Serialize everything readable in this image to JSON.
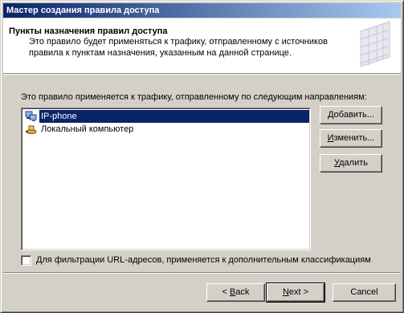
{
  "window": {
    "title": "Мастер создания правила доступа"
  },
  "header": {
    "title": "Пункты назначения правил доступа",
    "description": "Это правило будет применяться к трафику, отправленному с источников правила к пунктам назначения, указанным на данной странице."
  },
  "main": {
    "instruction": "Это правило применяется к трафику, отправленному по следующим направлениям:",
    "destinations": [
      {
        "label": "IP-phone",
        "icon": "network-icon",
        "selected": true
      },
      {
        "label": "Локальный компьютер",
        "icon": "local-computer-icon",
        "selected": false
      }
    ],
    "buttons": {
      "add": {
        "prefix": "",
        "mnemonic": "Д",
        "suffix": "обавить..."
      },
      "edit": {
        "prefix": "",
        "mnemonic": "И",
        "suffix": "зменить..."
      },
      "remove": {
        "prefix": "",
        "mnemonic": "У",
        "suffix": "далить"
      }
    },
    "url_filter_checkbox": {
      "mnemonic": "Д",
      "rest": "ля фильтрации URL-адресов, применяется к дополнительным классификациям",
      "checked": false
    }
  },
  "footer": {
    "back": {
      "prefix": "< ",
      "mnemonic": "B",
      "suffix": "ack"
    },
    "next": {
      "prefix": "",
      "mnemonic": "N",
      "suffix": "ext >"
    },
    "cancel": {
      "label": "Cancel"
    }
  },
  "colors": {
    "title_gradient_start": "#0a246a",
    "title_gradient_end": "#a6caf0",
    "selection": "#0a246a",
    "face": "#d4d0c8"
  }
}
